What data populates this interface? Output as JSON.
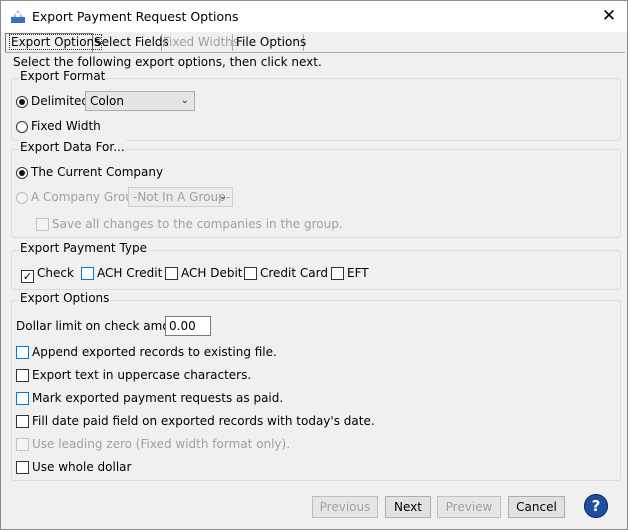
{
  "window": {
    "title": "Export Payment Request Options",
    "close_glyph": "✕"
  },
  "tabs": [
    {
      "label": "Export Options",
      "state": "active"
    },
    {
      "label": "Select Fields",
      "state": "normal"
    },
    {
      "label": "Fixed Widths",
      "state": "disabled"
    },
    {
      "label": "File Options",
      "state": "normal"
    }
  ],
  "intro": "Select the following export options, then click next.",
  "export_format": {
    "legend": "Export Format",
    "delimited_label": "Delimited",
    "delimiter_value": "Colon",
    "fixed_width_label": "Fixed Width",
    "selected": "Delimited"
  },
  "export_data_for": {
    "legend": "Export Data For...",
    "current_company_label": "The Current Company",
    "company_group_label": "A Company Group:",
    "company_group_value": "-Not In A Group-",
    "save_changes_label": "Save all changes to the companies in the group.",
    "selected": "The Current Company"
  },
  "payment_type": {
    "legend": "Export Payment Type",
    "check_label": "Check",
    "check_checked": true,
    "ach_credit_label": "ACH Credit",
    "ach_credit_checked": false,
    "ach_debit_label": "ACH Debit",
    "ach_debit_checked": false,
    "credit_card_label": "Credit Card",
    "credit_card_checked": false,
    "eft_label": "EFT",
    "eft_checked": false
  },
  "export_options": {
    "legend": "Export Options",
    "dollar_limit_label": "Dollar limit on check amounts:",
    "dollar_limit_value": "0.00",
    "append_label": "Append exported records to existing file.",
    "uppercase_label": "Export text in uppercase characters.",
    "mark_paid_label": "Mark exported payment requests as paid.",
    "fill_date_label": "Fill date paid field on exported records with today's date.",
    "leading_zero_label": "Use leading zero (Fixed width format only).",
    "whole_dollar_label": "Use whole dollar"
  },
  "buttons": {
    "previous": "Previous",
    "next": "Next",
    "preview": "Preview",
    "cancel": "Cancel",
    "help_glyph": "?"
  },
  "colors": {
    "accent_blue": "#0078d7",
    "help_blue": "#1f4f9e"
  }
}
